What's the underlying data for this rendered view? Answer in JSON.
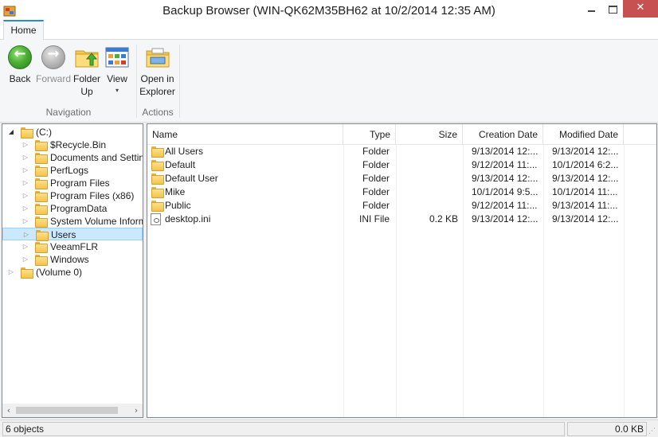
{
  "window": {
    "title": "Backup Browser (WIN-QK62M35BH62 at 10/2/2014 12:35 AM)",
    "close_glyph": "✕"
  },
  "ribbon": {
    "tabs": [
      {
        "label": "Home",
        "active": true
      }
    ],
    "groups": {
      "navigation": {
        "label": "Navigation",
        "buttons": {
          "back": {
            "label": "Back",
            "icon": "back-arrow-icon",
            "enabled": true
          },
          "forward": {
            "label": "Forward",
            "icon": "forward-arrow-icon",
            "enabled": false
          },
          "folder_up": {
            "label_line1": "Folder",
            "label_line2": "Up",
            "icon": "folder-up-icon"
          },
          "view": {
            "label": "View",
            "icon": "view-icon",
            "arrow": "▾"
          }
        }
      },
      "actions": {
        "label": "Actions",
        "buttons": {
          "open_in_explorer": {
            "label_line1": "Open in",
            "label_line2": "Explorer",
            "icon": "explorer-icon"
          }
        }
      }
    }
  },
  "tree": {
    "items": [
      {
        "label": "(C:)",
        "expander": "◢",
        "level": 0,
        "selected": false
      },
      {
        "label": "$Recycle.Bin",
        "expander": "▷",
        "level": 1,
        "selected": false
      },
      {
        "label": "Documents and Settings",
        "expander": "▷",
        "level": 1,
        "selected": false
      },
      {
        "label": "PerfLogs",
        "expander": "▷",
        "level": 1,
        "selected": false
      },
      {
        "label": "Program Files",
        "expander": "▷",
        "level": 1,
        "selected": false
      },
      {
        "label": "Program Files (x86)",
        "expander": "▷",
        "level": 1,
        "selected": false
      },
      {
        "label": "ProgramData",
        "expander": "▷",
        "level": 1,
        "selected": false
      },
      {
        "label": "System Volume Informat",
        "expander": "▷",
        "level": 1,
        "selected": false
      },
      {
        "label": "Users",
        "expander": "▷",
        "level": 1,
        "selected": true
      },
      {
        "label": "VeeamFLR",
        "expander": "▷",
        "level": 1,
        "selected": false
      },
      {
        "label": "Windows",
        "expander": "▷",
        "level": 1,
        "selected": false
      },
      {
        "label": "(Volume 0)",
        "expander": "▷",
        "level": 0,
        "selected": false
      }
    ],
    "scroll_left": "‹",
    "scroll_right": "›"
  },
  "list": {
    "columns": {
      "name": "Name",
      "type": "Type",
      "size": "Size",
      "created": "Creation Date",
      "modified": "Modified Date"
    },
    "rows": [
      {
        "name": "All Users",
        "type": "Folder",
        "size": "",
        "created": "9/13/2014 12:...",
        "modified": "9/13/2014 12:...",
        "icon": "folder-icon"
      },
      {
        "name": "Default",
        "type": "Folder",
        "size": "",
        "created": "9/12/2014 11:...",
        "modified": "10/1/2014 6:2...",
        "icon": "folder-icon"
      },
      {
        "name": "Default User",
        "type": "Folder",
        "size": "",
        "created": "9/13/2014 12:...",
        "modified": "9/13/2014 12:...",
        "icon": "folder-icon"
      },
      {
        "name": "Mike",
        "type": "Folder",
        "size": "",
        "created": "10/1/2014 9:5...",
        "modified": "10/1/2014 11:...",
        "icon": "folder-icon"
      },
      {
        "name": "Public",
        "type": "Folder",
        "size": "",
        "created": "9/12/2014 11:...",
        "modified": "9/13/2014 11:...",
        "icon": "folder-icon"
      },
      {
        "name": "desktop.ini",
        "type": "INI File",
        "size": "0.2 KB",
        "created": "9/13/2014 12:...",
        "modified": "9/13/2014 12:...",
        "icon": "ini-file-icon"
      }
    ]
  },
  "status": {
    "objects": "6 objects",
    "size": "0.0 KB"
  },
  "colors": {
    "accent": "#2a8ad4",
    "selection": "#cce8ff",
    "close_button": "#c75050"
  }
}
